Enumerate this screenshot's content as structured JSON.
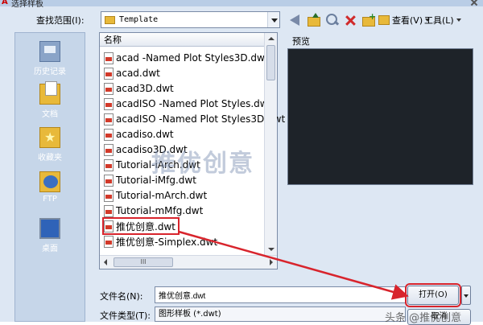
{
  "window": {
    "title": "选择样板"
  },
  "toolbar": {
    "look_in_label": "查找范围(I):",
    "look_in_value": "Template",
    "views_label": "查看(V)",
    "tools_label": "工具(L)"
  },
  "places": [
    {
      "label": "历史记录",
      "icon": "history-icon"
    },
    {
      "label": "文档",
      "icon": "documents-icon"
    },
    {
      "label": "收藏夹",
      "icon": "favorites-icon"
    },
    {
      "label": "FTP",
      "icon": "ftp-icon"
    },
    {
      "label": "桌面",
      "icon": "desktop-icon"
    }
  ],
  "file_list": {
    "header": "名称",
    "items": [
      "acad -Named Plot Styles3D.dwt",
      "acad.dwt",
      "acad3D.dwt",
      "acadISO -Named Plot Styles.dwt",
      "acadISO -Named Plot Styles3D.dwt",
      "acadiso.dwt",
      "acadiso3D.dwt",
      "Tutorial-iArch.dwt",
      "Tutorial-iMfg.dwt",
      "Tutorial-mArch.dwt",
      "Tutorial-mMfg.dwt",
      "推优创意.dwt",
      "推优创意-Simplex.dwt"
    ],
    "selected_index": 11,
    "hscroll_thumb": "III"
  },
  "preview": {
    "label": "预览"
  },
  "form": {
    "file_name_label": "文件名(N):",
    "file_name_value": "推优创意.dwt",
    "file_type_label": "文件类型(T):",
    "file_type_value": "图形样板 (*.dwt)"
  },
  "buttons": {
    "open_label": "打开(O)",
    "cancel_label": "取消"
  },
  "overlays": {
    "watermark_center": "推优创意",
    "watermark_corner": "头条 @推优创意"
  },
  "colors": {
    "highlight": "#d8242c",
    "preview_bg": "#1e2329"
  }
}
